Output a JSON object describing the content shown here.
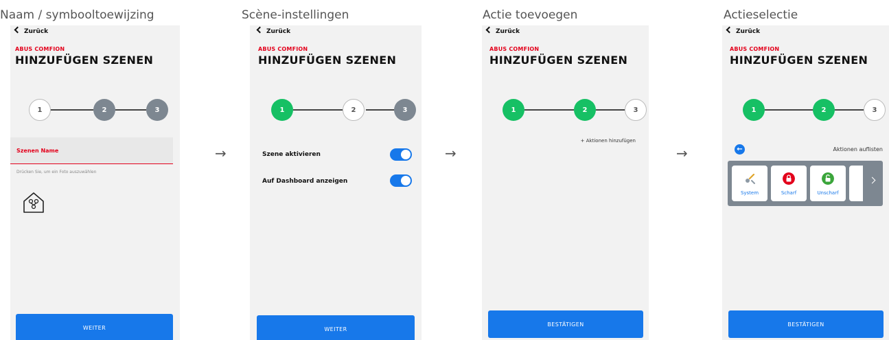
{
  "captions": [
    "Naam / symbooltoewijzing",
    "Scène-instellingen",
    "Actie toevoegen",
    "Actieselectie"
  ],
  "arrow_glyph": "→",
  "back_label": "Zurück",
  "brand": "ABUS COMFION",
  "title": "HINZUFÜGEN SZENEN",
  "steps": [
    "1",
    "2",
    "3"
  ],
  "colors": {
    "accent_blue": "#1778ea",
    "step_done": "#16c064",
    "step_pending": "#7d8791",
    "brand_red": "#e3001b"
  },
  "screen1": {
    "field_label": "Szenen Name",
    "hint": "Drücken Sie, um ein Foto auszuwählen",
    "icon": "smart-home-icon",
    "button": "WEITER"
  },
  "screen2": {
    "toggle1_label": "Szene aktivieren",
    "toggle1_on": true,
    "toggle2_label": "Auf Dashboard anzeigen",
    "toggle2_on": true,
    "button": "WEITER"
  },
  "screen3": {
    "add_action": "+ Aktionen hinzufügen",
    "button": "BESTÄTIGEN"
  },
  "screen4": {
    "list_actions": "Aktionen auflisten",
    "cards": [
      {
        "label": "System",
        "icon": "tools-icon"
      },
      {
        "label": "Scharf",
        "icon": "lock-closed-icon"
      },
      {
        "label": "Unscharf",
        "icon": "lock-open-icon"
      }
    ],
    "button": "BESTÄTIGEN"
  }
}
